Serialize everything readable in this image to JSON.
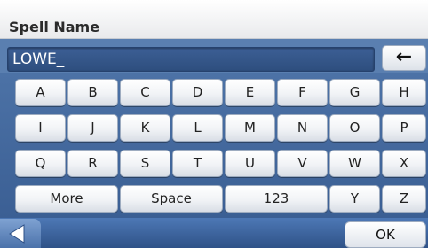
{
  "header": {
    "title": "Spell Name"
  },
  "entry": {
    "value": "LOWE_"
  },
  "controls": {
    "backspace_icon": "left-arrow-icon",
    "back_icon": "left-triangle-icon",
    "ok_label": "OK"
  },
  "keyboard": {
    "rows": [
      [
        "A",
        "B",
        "C",
        "D",
        "E",
        "F",
        "G",
        "H"
      ],
      [
        "I",
        "J",
        "K",
        "L",
        "M",
        "N",
        "O",
        "P"
      ],
      [
        "Q",
        "R",
        "S",
        "T",
        "U",
        "V",
        "W",
        "X"
      ],
      [
        "More",
        "Space",
        "123",
        "Y",
        "Z"
      ]
    ]
  },
  "colors": {
    "accent": "#3b5f94",
    "entry_bg": "#2e4e7e",
    "key_bg": "#f1f3f6"
  }
}
